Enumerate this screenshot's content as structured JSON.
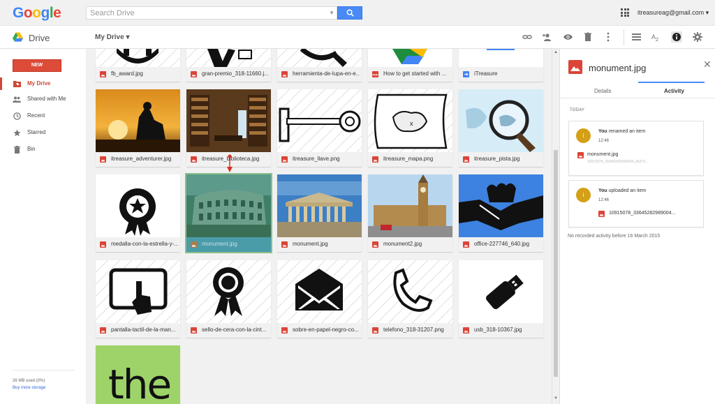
{
  "header": {
    "logo_letters": [
      {
        "ch": "G",
        "color": "#4285f4"
      },
      {
        "ch": "o",
        "color": "#ea4335"
      },
      {
        "ch": "o",
        "color": "#fbbc05"
      },
      {
        "ch": "g",
        "color": "#4285f4"
      },
      {
        "ch": "l",
        "color": "#34a853"
      },
      {
        "ch": "e",
        "color": "#ea4335"
      }
    ],
    "search_placeholder": "Search Drive",
    "account": "itreasureag@gmail.com ▾"
  },
  "subbar": {
    "app_name": "Drive",
    "location": "My Drive ▾",
    "toolbar_icons": [
      "link-icon",
      "add-person-icon",
      "preview-icon",
      "trash-icon",
      "more-vert-icon",
      "list-view-icon",
      "sort-az-icon",
      "info-icon",
      "settings-icon"
    ]
  },
  "sidebar": {
    "new_label": "NEW",
    "items": [
      {
        "label": "My Drive",
        "icon": "drive-folder-icon",
        "active": true
      },
      {
        "label": "Shared with Me",
        "icon": "people-icon",
        "active": false
      },
      {
        "label": "Recent",
        "icon": "clock-icon",
        "active": false
      },
      {
        "label": "Starred",
        "icon": "star-icon",
        "active": false
      },
      {
        "label": "Bin",
        "icon": "trash-icon",
        "active": false
      }
    ],
    "storage_used": "26 MB used (0%)",
    "buy_storage": "Buy more storage"
  },
  "files": {
    "row0": [
      {
        "name": "fb_award.jpg",
        "type": "image"
      },
      {
        "name": "gran-premio_318-11660.j...",
        "type": "image"
      },
      {
        "name": "herramienta-de-lupa-en-e...",
        "type": "image"
      },
      {
        "name": "How to get started with ...",
        "type": "pdf"
      },
      {
        "name": "iTreasure",
        "type": "shortcut"
      }
    ],
    "row1": [
      {
        "name": "itreasure_adventurer.jpg",
        "type": "image"
      },
      {
        "name": "itreasure_biblioteca.jpg",
        "type": "image"
      },
      {
        "name": "itreasure_llave.png",
        "type": "image"
      },
      {
        "name": "itreasure_mapa.png",
        "type": "image"
      },
      {
        "name": "itreasure_pista.jpg",
        "type": "image"
      }
    ],
    "row2": [
      {
        "name": "medalla-con-la-estrella-y-...",
        "type": "image"
      },
      {
        "name": "monument.jpg",
        "type": "image",
        "selected": true
      },
      {
        "name": "monument.jpg",
        "type": "image"
      },
      {
        "name": "monument2.jpg",
        "type": "image"
      },
      {
        "name": "office-227746_640.jpg",
        "type": "image"
      }
    ],
    "row3": [
      {
        "name": "pantalla-tactil-de-la-man...",
        "type": "image"
      },
      {
        "name": "sello-de-cera-con-la-cint...",
        "type": "image"
      },
      {
        "name": "sobre-en-papel-negro-co...",
        "type": "image"
      },
      {
        "name": "telefono_318-31207.png",
        "type": "image"
      },
      {
        "name": "usb_318-10367.jpg",
        "type": "image"
      }
    ],
    "row4_thumb_text": "the"
  },
  "panel": {
    "title": "monument.jpg",
    "tabs": {
      "details": "Details",
      "activity": "Activity"
    },
    "today": "TODAY",
    "activities": [
      {
        "avatar": "i",
        "actor": "You",
        "action": " renamed an item",
        "time": "12:46",
        "file": "monument.jpg",
        "file_sub": "10915078_336452829000044_81873..."
      },
      {
        "avatar": "i",
        "actor": "You",
        "action": " uploaded an item",
        "time": "12:46",
        "file": "10915078_33645282989004..."
      }
    ],
    "no_record": "No recorded activity before 16 March 2015"
  }
}
